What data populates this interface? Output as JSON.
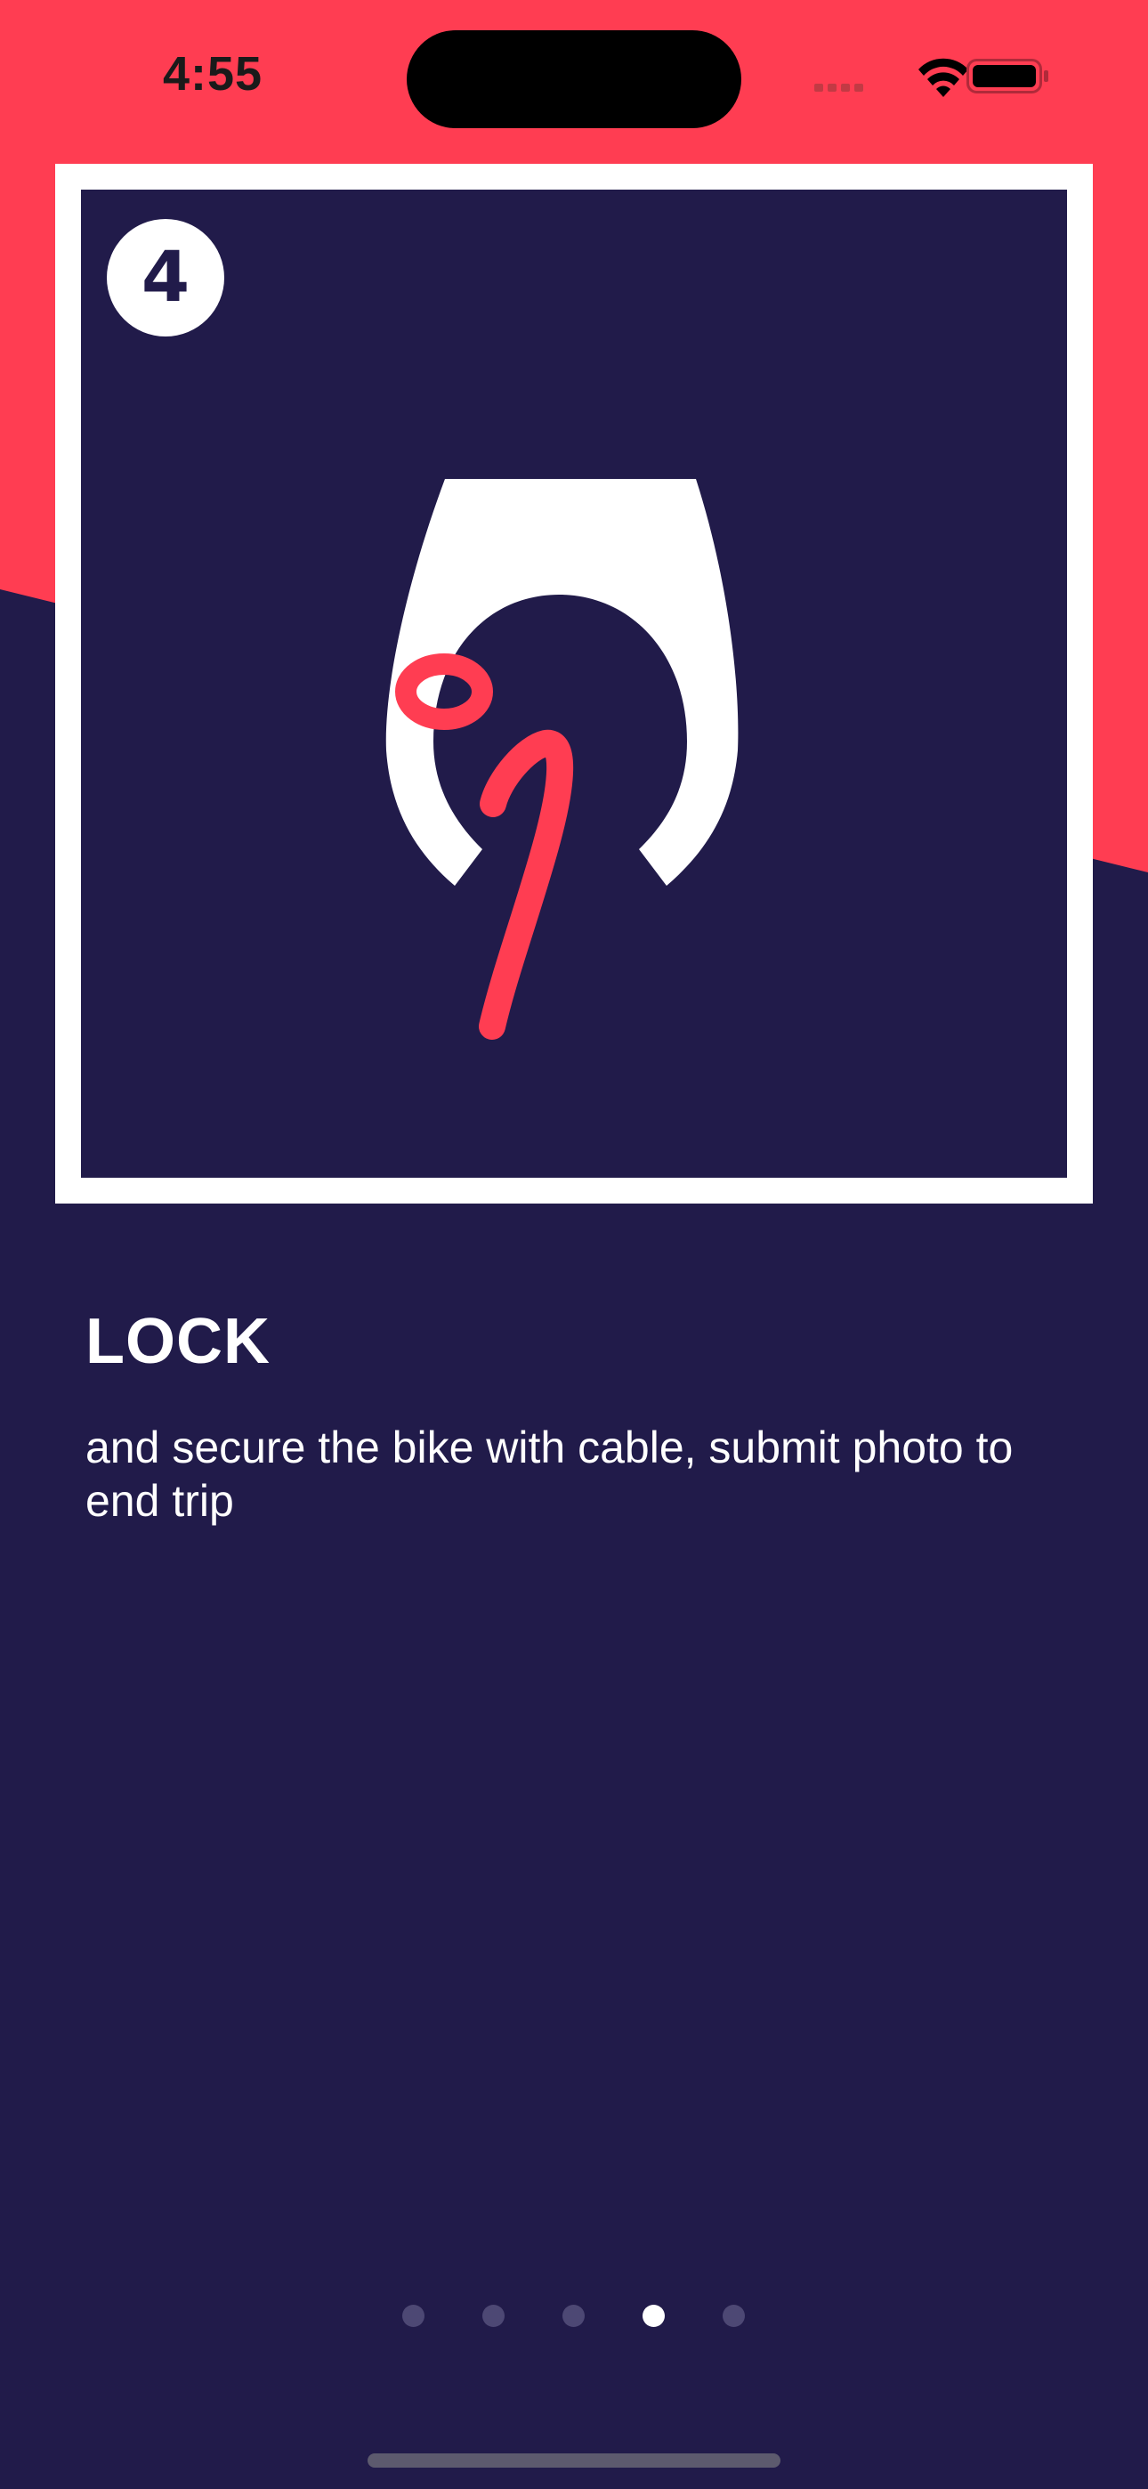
{
  "status_bar": {
    "time": "4:55"
  },
  "card": {
    "step_number": "4",
    "illustration_icon": "bike-frame-cable-lock-icon"
  },
  "content": {
    "title": "LOCK",
    "description": "and secure the bike with cable, submit photo to end trip"
  },
  "pager": {
    "total": 5,
    "active_index": 3
  },
  "colors": {
    "accent": "#ff3d52",
    "background": "#211b4a",
    "white": "#ffffff"
  }
}
